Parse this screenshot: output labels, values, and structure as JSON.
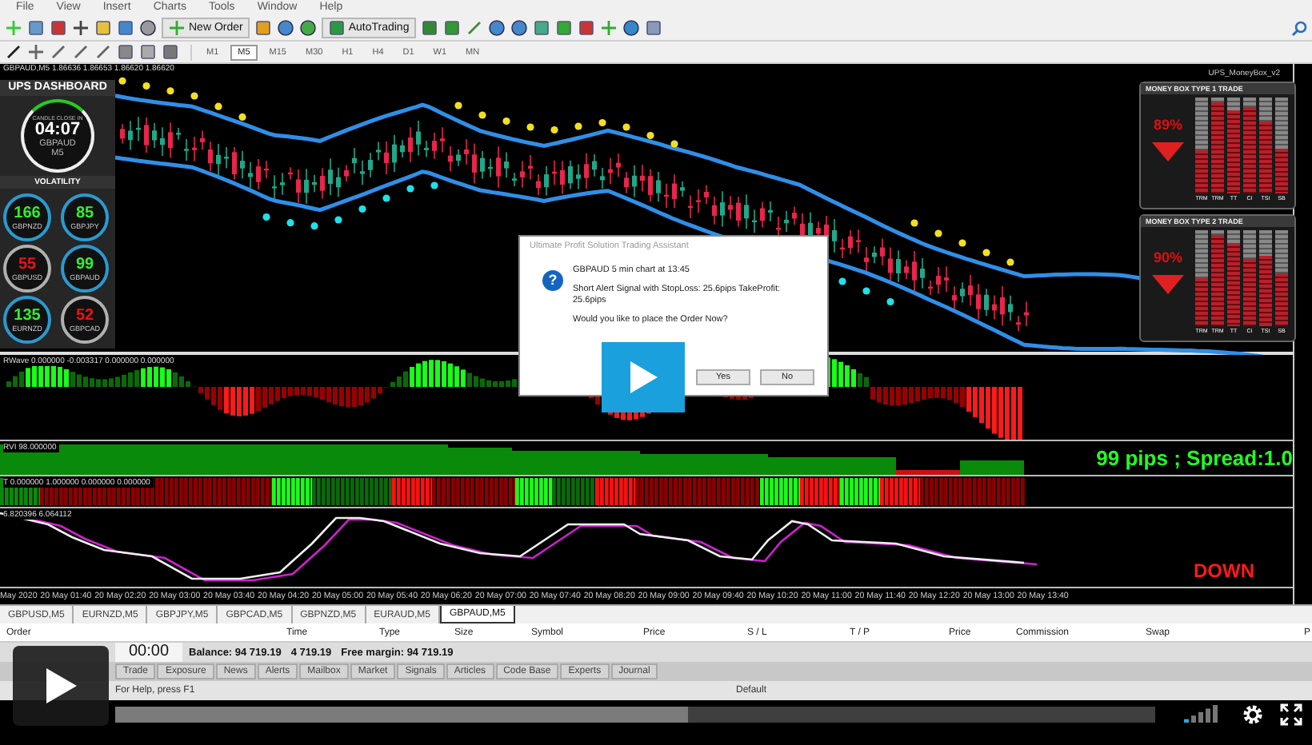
{
  "menu": [
    "File",
    "View",
    "Insert",
    "Charts",
    "Tools",
    "Window",
    "Help"
  ],
  "toolbar": {
    "new_order": "New Order",
    "auto_trading": "AutoTrading"
  },
  "timeframes": [
    {
      "label": "M1",
      "selected": false
    },
    {
      "label": "M5",
      "selected": true
    },
    {
      "label": "M15",
      "selected": false
    },
    {
      "label": "M30",
      "selected": false
    },
    {
      "label": "H1",
      "selected": false
    },
    {
      "label": "H4",
      "selected": false
    },
    {
      "label": "D1",
      "selected": false
    },
    {
      "label": "W1",
      "selected": false
    },
    {
      "label": "MN",
      "selected": false
    }
  ],
  "chart": {
    "header": "GBPAUD,M5  1.86636 1.86653 1.86620 1.86620",
    "indicator_name": "UPS_MoneyBox_v2",
    "panels": [
      {
        "kind": "histogram",
        "header": "RWave 0.000000 -0.003317 0.000000 0.000000"
      },
      {
        "kind": "area",
        "header": "RVI 98.000000",
        "note": "99 pips ; Spread:1.0"
      },
      {
        "kind": "blocks",
        "header": "T 0.000000 1.000000 0.000000 0.000000"
      },
      {
        "kind": "lines",
        "header": "6.820396 6.064112",
        "note": "DOWN"
      }
    ],
    "time_axis": [
      "May 2020",
      "20 May 01:40",
      "20 May 02:20",
      "20 May 03:00",
      "20 May 03:40",
      "20 May 04:20",
      "20 May 05:00",
      "20 May 05:40",
      "20 May 06:20",
      "20 May 07:00",
      "20 May 07:40",
      "20 May 08:20",
      "20 May 09:00",
      "20 May 09:40",
      "20 May 10:20",
      "20 May 11:00",
      "20 May 11:40",
      "20 May 12:20",
      "20 May 13:00",
      "20 May 13:40"
    ]
  },
  "dashboard": {
    "title": "UPS DASHBOARD",
    "clock_caption": "CANDLE CLOSE IN",
    "clock_time": "04:07",
    "clock_symbol": "GBPAUD",
    "clock_period": "M5",
    "volatility_title": "VOLATILITY",
    "pairs": [
      {
        "value": "166",
        "symbol": "GBPNZD",
        "color": "#33ee33",
        "kind": "strong"
      },
      {
        "value": "85",
        "symbol": "GBPJPY",
        "color": "#33ee33",
        "kind": "strong"
      },
      {
        "value": "55",
        "symbol": "GBPUSD",
        "color": "#ee1111",
        "kind": "weak"
      },
      {
        "value": "99",
        "symbol": "GBPAUD",
        "color": "#33ee33",
        "kind": "strong"
      },
      {
        "value": "135",
        "symbol": "EURNZD",
        "color": "#33ee33",
        "kind": "strong"
      },
      {
        "value": "52",
        "symbol": "GBPCAD",
        "color": "#ee1111",
        "kind": "weak"
      }
    ]
  },
  "money_boxes": [
    {
      "title": "MONEY BOX TYPE 1 TRADE",
      "percent": "89%",
      "bars": [
        {
          "label": "TRM",
          "level": 0.45
        },
        {
          "label": "TRM",
          "level": 0.95
        },
        {
          "label": "TT",
          "level": 0.87
        },
        {
          "label": "CI",
          "level": 0.9
        },
        {
          "label": "TSI",
          "level": 0.75
        },
        {
          "label": "SB",
          "level": 0.46
        }
      ]
    },
    {
      "title": "MONEY BOX TYPE 2 TRADE",
      "percent": "90%",
      "bars": [
        {
          "label": "TRM",
          "level": 0.5
        },
        {
          "label": "TRM",
          "level": 0.95
        },
        {
          "label": "TT",
          "level": 0.87
        },
        {
          "label": "CI",
          "level": 0.7
        },
        {
          "label": "TSI",
          "level": 0.73
        },
        {
          "label": "SB",
          "level": 0.55
        }
      ]
    }
  ],
  "dialog": {
    "title": "Ultimate Profit Solution Trading Assistant",
    "icon": "?",
    "lines": [
      "GBPAUD 5 min chart at 13:45",
      "Short Alert Signal with StopLoss: 25.6pips  TakeProfit: 25.6pips",
      "Would you like to place the Order Now?"
    ],
    "buttons": [
      "Yes",
      "No"
    ]
  },
  "symbol_tabs": [
    {
      "label": "GBPUSD,M5",
      "selected": false
    },
    {
      "label": "EURNZD,M5",
      "selected": false
    },
    {
      "label": "GBPJPY,M5",
      "selected": false
    },
    {
      "label": "GBPCAD,M5",
      "selected": false
    },
    {
      "label": "GBPNZD,M5",
      "selected": false
    },
    {
      "label": "EURAUD,M5",
      "selected": false
    },
    {
      "label": "GBPAUD,M5",
      "selected": true
    }
  ],
  "terminal": {
    "columns": [
      "Order",
      "Time",
      "Type",
      "Size",
      "Symbol",
      "Price",
      "S / L",
      "T / P",
      "Price",
      "Commission",
      "Swap",
      "P"
    ],
    "balance": [
      "Balance: 94 719.19",
      "4 719.19",
      "Free margin: 94 719.19"
    ],
    "tabs": [
      "Trade",
      "Exposure",
      "News",
      "Alerts",
      "Mailbox",
      "Market",
      "Signals",
      "Articles",
      "Code Base",
      "Experts",
      "Journal"
    ],
    "status_help": "For Help, press F1",
    "status_profile": "Default"
  },
  "video": {
    "time": "00:00",
    "buffered": {
      "level": 0.55
    }
  }
}
